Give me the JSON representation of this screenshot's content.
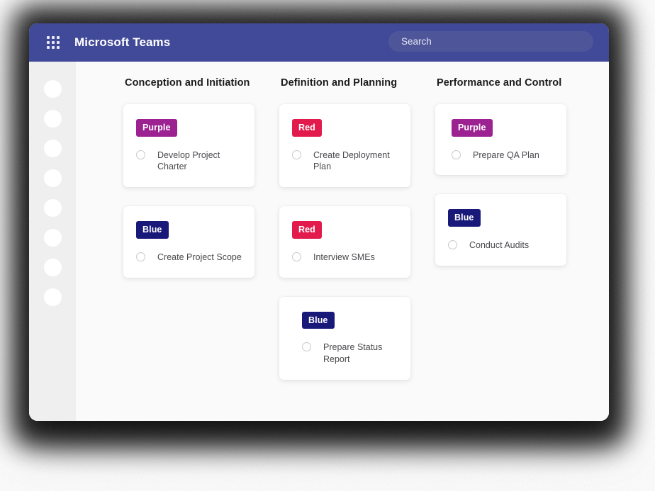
{
  "window": {
    "header": {
      "waffle_icon": "grid-apps-icon",
      "title": "Microsoft Teams",
      "bar_color": "#414a99"
    },
    "search": {
      "placeholder": "Search",
      "value": "",
      "icon": "search-icon"
    }
  },
  "sidebar": {
    "background": "#efeff0",
    "items": [
      {
        "icon": "circle-placeholder-icon"
      },
      {
        "icon": "circle-placeholder-icon"
      },
      {
        "icon": "circle-placeholder-icon"
      },
      {
        "icon": "circle-placeholder-icon"
      },
      {
        "icon": "circle-placeholder-icon"
      },
      {
        "icon": "circle-placeholder-icon"
      },
      {
        "icon": "circle-placeholder-icon"
      },
      {
        "icon": "circle-placeholder-icon"
      }
    ]
  },
  "board": {
    "background": "#fafafa",
    "badge_colors": {
      "Purple": "#9c2292",
      "Blue": "#191979",
      "Red": "#e21b4c"
    },
    "columns": [
      {
        "title": "Conception and Initiation",
        "cards": [
          {
            "badge": "Purple",
            "task": "Develop Project Charter",
            "checked": false
          },
          {
            "badge": "Blue",
            "task": "Create Project Scope",
            "checked": false
          }
        ]
      },
      {
        "title": "Definition and Planning",
        "cards": [
          {
            "badge": "Red",
            "task": "Create Deployment Plan",
            "checked": false
          },
          {
            "badge": "Red",
            "task": "Interview SMEs",
            "checked": false
          },
          {
            "badge": "Blue",
            "task": "Prepare Status Report",
            "checked": false
          }
        ]
      },
      {
        "title": "Performance and Control",
        "cards": [
          {
            "badge": "Purple",
            "task": "Prepare QA Plan",
            "checked": false
          },
          {
            "badge": "Blue",
            "task": "Conduct Audits",
            "checked": false
          }
        ]
      }
    ]
  }
}
